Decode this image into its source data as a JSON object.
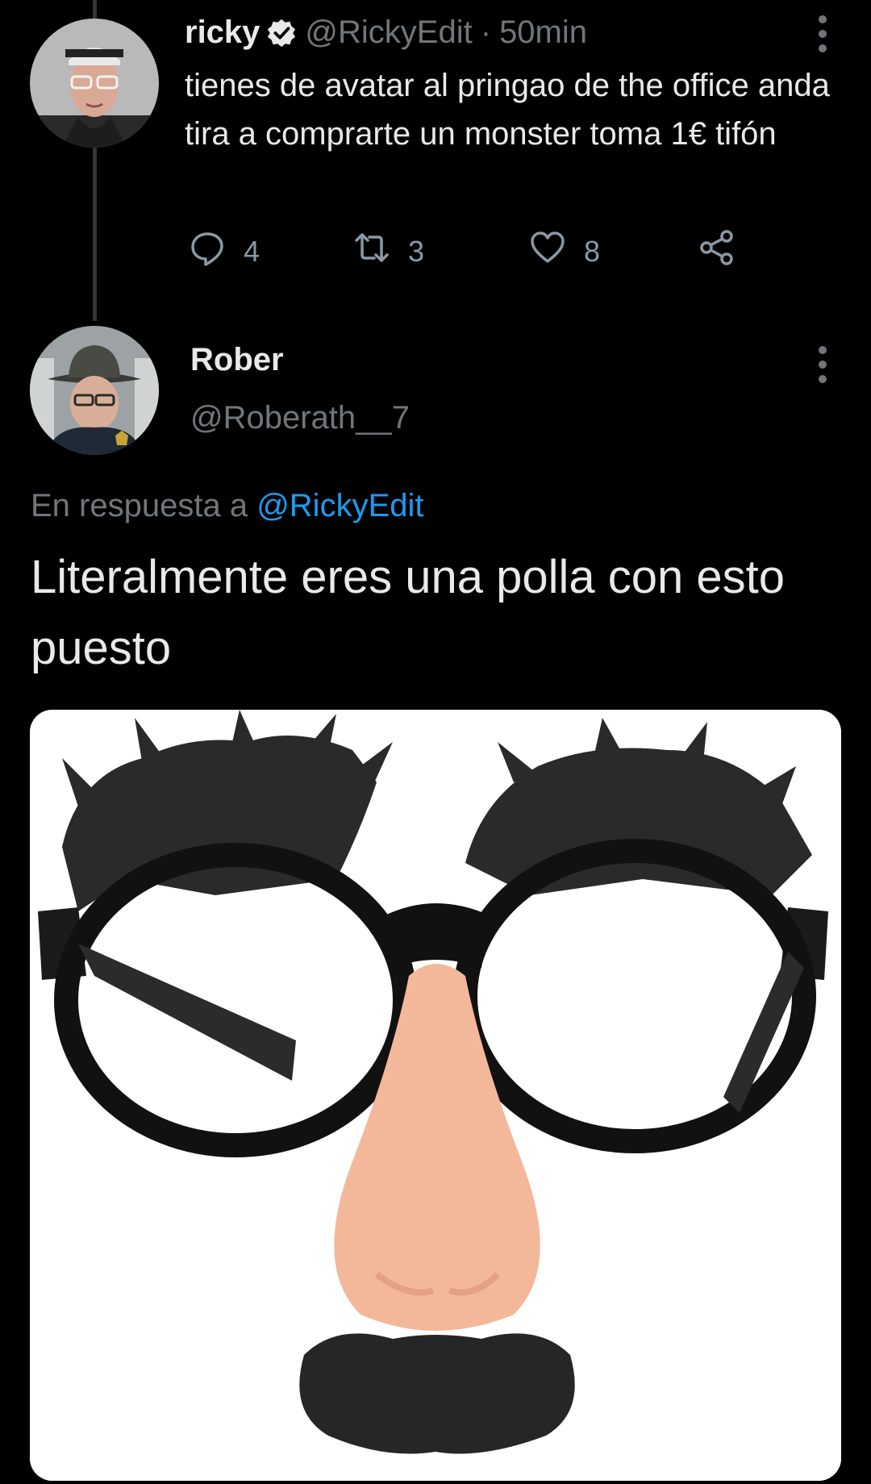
{
  "tweet1": {
    "display_name": "ricky",
    "handle": "@RickyEdit",
    "separator": "·",
    "time": "50min",
    "text": "tienes de avatar al pringao de the office anda tira a comprarte un monster toma 1€ tifón",
    "actions": {
      "replies": "4",
      "retweets": "3",
      "likes": "8"
    },
    "icons": [
      "verified-badge-icon",
      "more-options-icon",
      "reply-icon",
      "retweet-icon",
      "like-icon",
      "share-icon"
    ]
  },
  "tweet2": {
    "display_name": "Rober",
    "handle": "@Roberath__7",
    "reply_prefix": "En respuesta a",
    "reply_to": "@RickyEdit",
    "text": "Literalmente eres una polla con esto puesto",
    "media": "novelty glasses with bushy eyebrows, fake nose and mustache"
  },
  "colors": {
    "background": "#000000",
    "text": "#e7e9ea",
    "muted": "#71767b",
    "link": "#1d9bf0",
    "thread_line": "#333639"
  }
}
